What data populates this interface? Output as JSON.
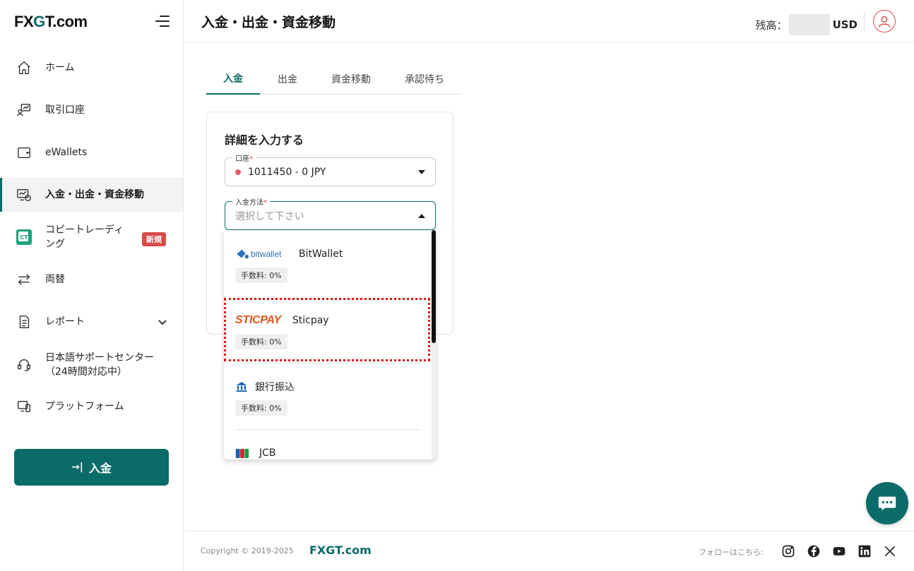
{
  "brand": {
    "logo_prefix": "FX",
    "logo_g": "G",
    "logo_suffix": "T.com"
  },
  "sidebar": {
    "items": [
      {
        "label": "ホーム",
        "icon": "home-icon"
      },
      {
        "label": "取引口座",
        "icon": "trading-account-icon"
      },
      {
        "label": "eWallets",
        "icon": "wallet-icon"
      },
      {
        "label": "入金・出金・資金移動",
        "icon": "funds-icon",
        "active": true
      },
      {
        "label": "コピートレーディング",
        "label_line1": "コピートレーディ",
        "label_line2": "ング",
        "icon": "copy-trading-icon",
        "badge": "新規"
      },
      {
        "label": "両替",
        "icon": "exchange-icon"
      },
      {
        "label": "レポート",
        "icon": "report-icon"
      },
      {
        "label_line1": "日本語サポートセンター",
        "label_line2": "（24時間対応中）",
        "icon": "support-icon"
      },
      {
        "label": "プラットフォーム",
        "icon": "platform-icon"
      }
    ],
    "ct_icon_text": "CT",
    "deposit_button": "入金"
  },
  "header": {
    "title": "入金・出金・資金移動",
    "balance_label": "残高：",
    "balance_currency": "USD"
  },
  "tabs": [
    "入金",
    "出金",
    "資金移動",
    "承認待ち"
  ],
  "form": {
    "title": "詳細を入力する",
    "account_label": "口座",
    "account_value": "1011450 - 0 JPY",
    "method_label": "入金方法",
    "method_placeholder": "選択して下さい",
    "required_mark": "*"
  },
  "payment_methods": [
    {
      "name": "BitWallet",
      "logo_text": "bitwallet",
      "fee": "手数料: 0%"
    },
    {
      "name": "Sticpay",
      "logo_text": "STICPAY",
      "fee": "手数料: 0%"
    },
    {
      "name": "銀行振込",
      "fee": "手数料: 0%"
    },
    {
      "name": "JCB"
    }
  ],
  "footer": {
    "copyright": "Copyright © 2019-2025",
    "brand": "FXGT.com",
    "follow": "フォローはこちら:"
  },
  "colors": {
    "accent": "#0b6b68",
    "badge": "#d94b4b",
    "highlight": "#e01212",
    "sticpay": "#d9571a",
    "bitwallet": "#2d6fbf"
  }
}
